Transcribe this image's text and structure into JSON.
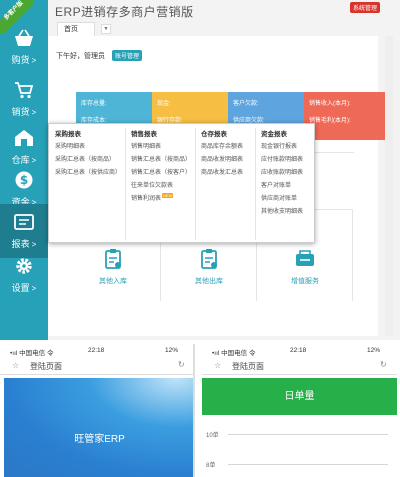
{
  "ribbon": "多客户版",
  "app": {
    "title": "ERP进销存多商户营销版",
    "system_badge": "系统管理"
  },
  "sidebar": {
    "items": [
      {
        "label": "购货",
        "icon": "basket-icon"
      },
      {
        "label": "销货",
        "icon": "cart-icon"
      },
      {
        "label": "仓库",
        "icon": "warehouse-icon"
      },
      {
        "label": "资金",
        "icon": "dollar-icon"
      },
      {
        "label": "报表",
        "icon": "report-icon"
      },
      {
        "label": "设置",
        "icon": "gear-icon"
      }
    ],
    "chevron": ">"
  },
  "tabs": {
    "home": "首页",
    "caret": "▼"
  },
  "greeting": "下午好，管理员",
  "account_button": "账号管理",
  "stats": [
    {
      "line1": "库存总量:",
      "line2": "库存成本:"
    },
    {
      "line1": "现金:",
      "line2": "银行存款:"
    },
    {
      "line1": "客户欠款:",
      "line2": "供应商欠款:"
    },
    {
      "line1": "销售收入(本月):",
      "line2": "销售毛利(本月):"
    }
  ],
  "report_menu": {
    "columns": [
      {
        "title": "采购报表",
        "items": [
          "采购明细表",
          "采购汇总表（按商品）",
          "采购汇总表（按供应商）"
        ]
      },
      {
        "title": "销售报表",
        "items": [
          "销售明细表",
          "销售汇总表（按商品）",
          "销售汇总表（按客户）",
          "往来单位欠款表",
          "销售利润表"
        ]
      },
      {
        "title": "仓存报表",
        "items": [
          "商品库存余额表",
          "商品收发明细表",
          "商品收发汇总表"
        ]
      },
      {
        "title": "资金报表",
        "items": [
          "现金银行报表",
          "应付账款明细表",
          "应收账款明细表",
          "客户对账单",
          "供应商对账单",
          "其他收支明细表"
        ]
      }
    ],
    "new_badge": "NEW"
  },
  "grid_cards": [
    {
      "label": "其他入库",
      "icon": "clipboard-in-icon"
    },
    {
      "label": "其他出库",
      "icon": "clipboard-out-icon"
    },
    {
      "label": "增值服务",
      "icon": "service-icon"
    }
  ],
  "phone_status": {
    "carrier": "•ııl 中国电信 令",
    "time": "22:18",
    "battery": "12%"
  },
  "phone_left": {
    "page_title": "登陆页面",
    "splash_text": "旺管家ERP"
  },
  "phone_right": {
    "page_title": "登陆页面",
    "header": "日单量",
    "y_ticks": [
      "10单",
      "8单"
    ]
  },
  "colors": {
    "teal": "#27a1b8",
    "green": "#27b04a",
    "blue": "#2a7fd0"
  }
}
